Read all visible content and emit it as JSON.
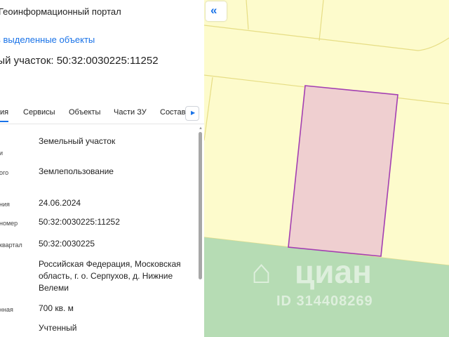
{
  "panel": {
    "portal_title": "Геоинформационный портал",
    "add_link": "в выделенные объекты",
    "parcel_title": "ный участок: 50:32:0030225:11252",
    "tabs": [
      {
        "label": "ия",
        "active": true
      },
      {
        "label": "Сервисы",
        "active": false
      },
      {
        "label": "Объекты",
        "active": false
      },
      {
        "label": "Части ЗУ",
        "active": false
      },
      {
        "label": "Состав",
        "active": false
      }
    ],
    "tab_arrow": "▶",
    "rows": [
      {
        "label": "и",
        "value": "Земельный участок"
      },
      {
        "label": "ого",
        "value": "Землепользование"
      },
      {
        "label": "ния",
        "value": "24.06.2024"
      },
      {
        "label": "номер",
        "value": "50:32:0030225:11252"
      },
      {
        "label": "квартал",
        "value": "50:32:0030225"
      },
      {
        "label": "",
        "value": "Российская Федерация, Московская область, г. о. Серпухов, д. Нижние Велеми"
      },
      {
        "label": "нная",
        "value": "700 кв. м"
      },
      {
        "label": "",
        "value": "Учтенный"
      }
    ]
  },
  "map": {
    "collapse_icon": "«",
    "watermark_logo": "⌂",
    "watermark_brand": "циан",
    "watermark_id": "ID 314408269",
    "colors": {
      "background": "#fdfbcc",
      "lines": "#e6dd84",
      "green_zone": "#b6dcb4",
      "parcel_fill": "#efcfd0",
      "parcel_stroke": "#a33fb2"
    }
  }
}
